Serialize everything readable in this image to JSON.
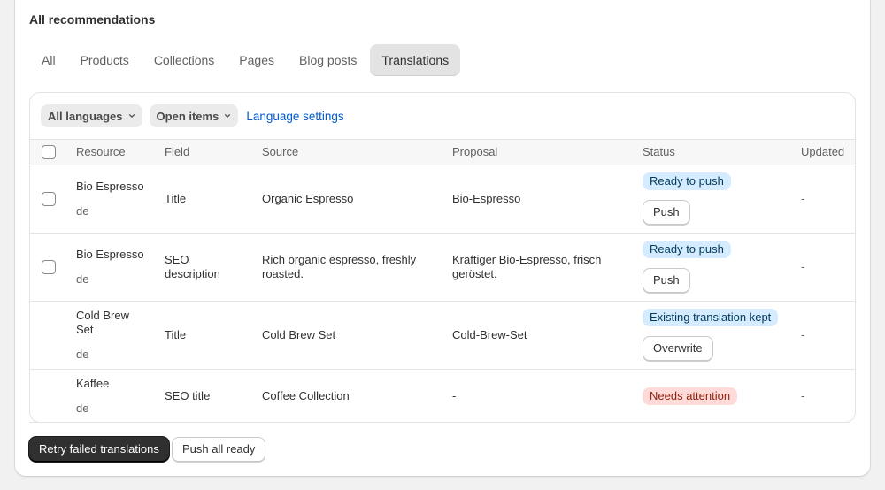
{
  "card": {
    "title": "All recommendations"
  },
  "tabs": [
    {
      "label": "All"
    },
    {
      "label": "Products"
    },
    {
      "label": "Collections"
    },
    {
      "label": "Pages"
    },
    {
      "label": "Blog posts"
    },
    {
      "label": "Translations",
      "active": true
    }
  ],
  "filters": {
    "languages": "All languages",
    "status": "Open items",
    "settings_link": "Language settings"
  },
  "table": {
    "columns": [
      "Resource",
      "Field",
      "Source",
      "Proposal",
      "Status",
      "Updated"
    ],
    "rows": [
      {
        "resource": "Bio Espresso",
        "locale": "de",
        "field": "Title",
        "source": "Organic Espresso",
        "proposal": "Bio-Espresso",
        "status": "Ready to push",
        "action": "Push",
        "updated": "-"
      },
      {
        "resource": "Bio Espresso",
        "locale": "de",
        "field": "SEO description",
        "source": "Rich organic espresso, freshly roasted.",
        "proposal": "Kräftiger Bio-Espresso, frisch geröstet.",
        "status": "Ready to push",
        "action": "Push",
        "updated": "-"
      },
      {
        "resource": "Cold Brew Set",
        "locale": "de",
        "field": "Title",
        "source": "Cold Brew Set",
        "proposal": "Cold-Brew-Set",
        "status": "Existing translation kept",
        "action": "Overwrite",
        "updated": "-"
      },
      {
        "resource": "Kaffee",
        "locale": "de",
        "field": "SEO title",
        "source": "Coffee Collection",
        "proposal": "-",
        "status": "Needs attention",
        "action": "",
        "updated": "-"
      }
    ]
  },
  "actions": {
    "retry": "Retry failed translations",
    "push_all": "Push all ready"
  },
  "colors": {
    "info_badge": "#d5ebff",
    "critical_badge": "#fedad9",
    "link": "#005bd3",
    "primary_button": "#303030"
  }
}
